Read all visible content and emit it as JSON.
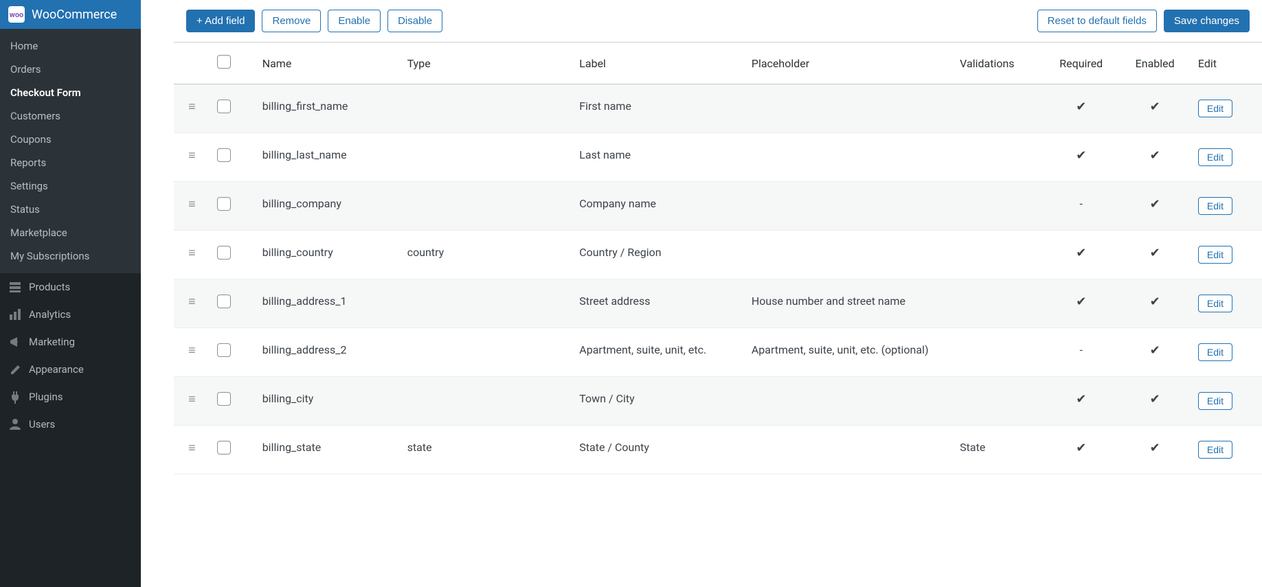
{
  "sidebar": {
    "header": "WooCommerce",
    "woo_icon": "woo",
    "submenu": [
      {
        "label": "Home",
        "active": false
      },
      {
        "label": "Orders",
        "active": false
      },
      {
        "label": "Checkout Form",
        "active": true
      },
      {
        "label": "Customers",
        "active": false
      },
      {
        "label": "Coupons",
        "active": false
      },
      {
        "label": "Reports",
        "active": false
      },
      {
        "label": "Settings",
        "active": false
      },
      {
        "label": "Status",
        "active": false
      },
      {
        "label": "Marketplace",
        "active": false
      },
      {
        "label": "My Subscriptions",
        "active": false
      }
    ],
    "menu": [
      {
        "icon": "products-icon",
        "label": "Products"
      },
      {
        "icon": "analytics-icon",
        "label": "Analytics"
      },
      {
        "icon": "marketing-icon",
        "label": "Marketing"
      },
      {
        "icon": "appearance-icon",
        "label": "Appearance"
      },
      {
        "icon": "plugins-icon",
        "label": "Plugins"
      },
      {
        "icon": "users-icon",
        "label": "Users"
      }
    ]
  },
  "toolbar": {
    "add_field": "+ Add field",
    "remove": "Remove",
    "enable": "Enable",
    "disable": "Disable",
    "reset": "Reset to default fields",
    "save": "Save changes"
  },
  "columns": {
    "name": "Name",
    "type": "Type",
    "label": "Label",
    "placeholder": "Placeholder",
    "validations": "Validations",
    "required": "Required",
    "enabled": "Enabled",
    "edit": "Edit"
  },
  "edit_button_label": "Edit",
  "check": "✔",
  "dash": "-",
  "rows": [
    {
      "name": "billing_first_name",
      "type": "",
      "label": "First name",
      "placeholder": "",
      "validations": "",
      "required": "check",
      "enabled": "check"
    },
    {
      "name": "billing_last_name",
      "type": "",
      "label": "Last name",
      "placeholder": "",
      "validations": "",
      "required": "check",
      "enabled": "check"
    },
    {
      "name": "billing_company",
      "type": "",
      "label": "Company name",
      "placeholder": "",
      "validations": "",
      "required": "dash",
      "enabled": "check"
    },
    {
      "name": "billing_country",
      "type": "country",
      "label": "Country / Region",
      "placeholder": "",
      "validations": "",
      "required": "check",
      "enabled": "check"
    },
    {
      "name": "billing_address_1",
      "type": "",
      "label": "Street address",
      "placeholder": "House number and street name",
      "validations": "",
      "required": "check",
      "enabled": "check"
    },
    {
      "name": "billing_address_2",
      "type": "",
      "label": "Apartment, suite, unit, etc.",
      "placeholder": "Apartment, suite, unit, etc. (optional)",
      "validations": "",
      "required": "dash",
      "enabled": "check"
    },
    {
      "name": "billing_city",
      "type": "",
      "label": "Town / City",
      "placeholder": "",
      "validations": "",
      "required": "check",
      "enabled": "check"
    },
    {
      "name": "billing_state",
      "type": "state",
      "label": "State / County",
      "placeholder": "",
      "validations": "State",
      "required": "check",
      "enabled": "check"
    }
  ]
}
